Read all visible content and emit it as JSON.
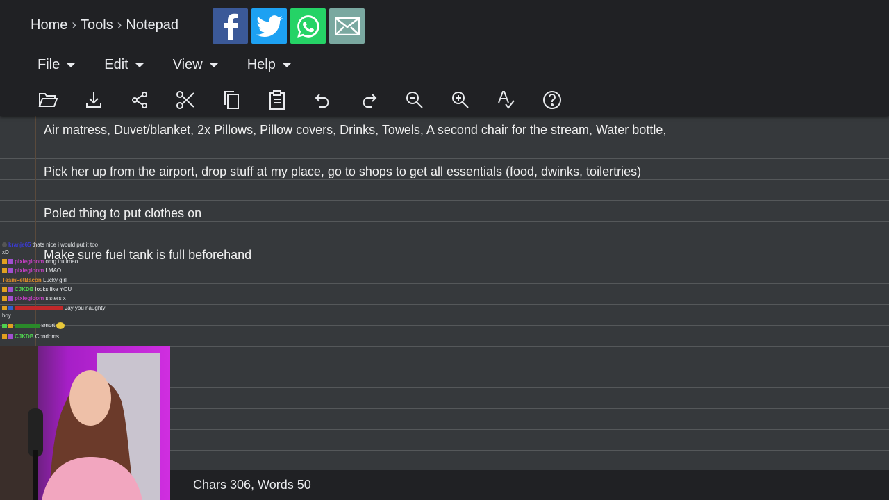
{
  "breadcrumb": {
    "home": "Home",
    "tools": "Tools",
    "current": "Notepad",
    "separator": "›"
  },
  "share": [
    {
      "name": "facebook-share-button",
      "icon": "facebook-icon",
      "color": "#3b5998"
    },
    {
      "name": "twitter-share-button",
      "icon": "twitter-icon",
      "color": "#1da1f2"
    },
    {
      "name": "whatsapp-share-button",
      "icon": "whatsapp-icon",
      "color": "#25d366"
    },
    {
      "name": "email-share-button",
      "icon": "mail-icon",
      "color": "#7aa8a0"
    }
  ],
  "menu": {
    "file": "File",
    "edit": "Edit",
    "view": "View",
    "help": "Help"
  },
  "toolbar": [
    "open-folder-icon",
    "download-icon",
    "share-icon",
    "cut-icon",
    "copy-icon",
    "paste-icon",
    "undo-icon",
    "redo-icon",
    "zoom-out-icon",
    "zoom-in-icon",
    "spellcheck-icon",
    "help-icon"
  ],
  "notepad": {
    "lines": [
      " Air matress, Duvet/blanket, 2x Pillows, Pillow covers,  Drinks, Towels, A second chair for the stream, Water bottle,",
      "Pick her up from the airport, drop stuff at my place, go to shops to get all essentials (food, dwinks, toilertries)",
      "Poled thing to put clothes on",
      "Make sure fuel tank is full beforehand"
    ]
  },
  "chat": [
    {
      "user": "kranje65",
      "text": "thats nice i would put it too",
      "color": "#3b3bd6"
    },
    {
      "user": "",
      "text": "xD",
      "color": "#e8eaed"
    },
    {
      "user": "pixiegloom",
      "text": "omg tru lmao",
      "color": "#c73fc7"
    },
    {
      "user": "pixiegloom",
      "text": "LMAO",
      "color": "#c73fc7"
    },
    {
      "user": "TeamFetBacon",
      "text": "Lucky girl",
      "color": "#d98c2b"
    },
    {
      "user": "CJKDB",
      "text": "looks like YOU",
      "color": "#4fd14f"
    },
    {
      "user": "pixiegloom",
      "text": "sisters x",
      "color": "#c73fc7"
    },
    {
      "user": "",
      "text": "Jay you naughty",
      "color": "#e8eaed"
    },
    {
      "user": "",
      "text": "boy",
      "color": "#e8eaed"
    },
    {
      "user": "",
      "text": "smort",
      "color": "#e8eaed"
    },
    {
      "user": "CJKDB",
      "text": "Condoms",
      "color": "#4fd14f"
    }
  ],
  "status": {
    "text": "Chars 306, Words 50"
  }
}
